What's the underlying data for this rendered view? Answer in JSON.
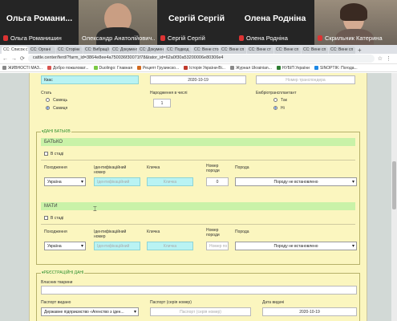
{
  "participants": {
    "tile1": {
      "big": "Ольга Романи...",
      "small": "Ольга Романишин"
    },
    "tile2": {
      "small": "Олександр Анатолійович..."
    },
    "tile3": {
      "big": "Сергій Сергій",
      "small": "Сергій Сергій"
    },
    "tile4": {
      "big": "Олена Роднiна",
      "small": "Олена Роднiна"
    },
    "tile5": {
      "small": "Скрильник Катерина"
    }
  },
  "tabs": [
    "СС: Список с",
    "СС: Органі",
    "СС: Сторінк",
    "СС: Вибрації",
    "СС: Документ",
    "СС: Докумен",
    "СС: Подвод",
    "СС: Вене сто",
    "СС: Вене сп",
    "СС: Вене ст",
    "СС: Вене сп",
    "СС: Вене сп",
    "СС: Вене сп"
  ],
  "address": {
    "url": "cattle.center/ferd/?farm_id=3864e8ee4a750036f30071f78&tator_id=62a0f30a53200006e80306e4"
  },
  "bookmarks": [
    {
      "label": "ЖИВНОСТІ МАЗ...",
      "color": "#888"
    },
    {
      "label": "Добро пожаловат...",
      "color": "#d9534f"
    },
    {
      "label": "Duolingo: Главная",
      "color": "#7ac943"
    },
    {
      "label": "Рецепт Грузинско...",
      "color": "#d2691e"
    },
    {
      "label": "Історія України-Ві...",
      "color": "#c0392b"
    },
    {
      "label": "Журнал Ukrainian...",
      "color": "#888"
    },
    {
      "label": "НУБІП України",
      "color": "#2e7d32"
    },
    {
      "label": "SINOPTIK: Погода...",
      "color": "#1e88e5"
    }
  ],
  "form": {
    "top": {
      "kvas": "Квас",
      "date": "2020-10-19",
      "num_ph": "Номер транспондера"
    },
    "sex_label": "Стать",
    "sex_options": [
      "Самець",
      "Самиця"
    ],
    "birth_label": "Народження в числі",
    "birth_value": "1",
    "embryo_label": "Ембріотрансплантант",
    "embryo_options": [
      "Так",
      "Ні"
    ],
    "parents_legend": "ДАНІ БАТЬКІВ",
    "father": {
      "title": "БАТЬКО",
      "herd_check": "В стаді",
      "labels": {
        "origin": "Походження",
        "id": "Ідентифікаційний номер",
        "nick": "Кличка",
        "num": "Номер породи",
        "breed": "Порода"
      },
      "origin": "Україна",
      "id_ph": "Ідентифікаційний",
      "nick_ph": "Кличка",
      "num": "0",
      "breed": "Породу не встановлено"
    },
    "mother": {
      "title": "МАТИ",
      "herd_check": "В стаді",
      "labels": {
        "origin": "Походження",
        "id": "Ідентифікаційний номер",
        "nick": "Кличка",
        "num": "Номер породи",
        "breed": "Порода"
      },
      "origin": "Україна",
      "id_ph": "Ідентифікаційний",
      "nick_ph": "Кличка",
      "num_ph": "Номер по",
      "breed": "Породу не встановлено"
    },
    "reg_legend": "РЕЄСТРАЦІЙНІ ДАНІ",
    "reg": {
      "owner_label": "Власник тварини",
      "passport_issued_label": "Паспорт видано",
      "passport_num_label": "Паспорт (серія номер)",
      "issue_date_label": "Дата видачі",
      "issuer": "Державне підприємство «Агенство з іден...",
      "passport_ph": "Паспорт (серія номер)",
      "issue_date": "2020-10-19"
    }
  }
}
